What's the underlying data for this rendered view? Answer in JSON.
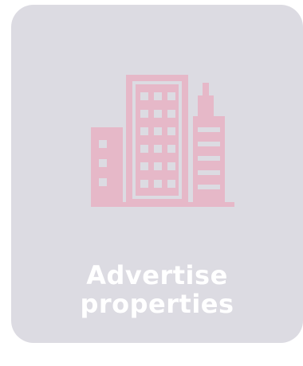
{
  "card": {
    "title": "Advertise properties",
    "icon": "buildings-icon",
    "colors": {
      "background": "#dcdbe2",
      "icon": "#e6b8c8",
      "text": "#ffffff"
    }
  }
}
